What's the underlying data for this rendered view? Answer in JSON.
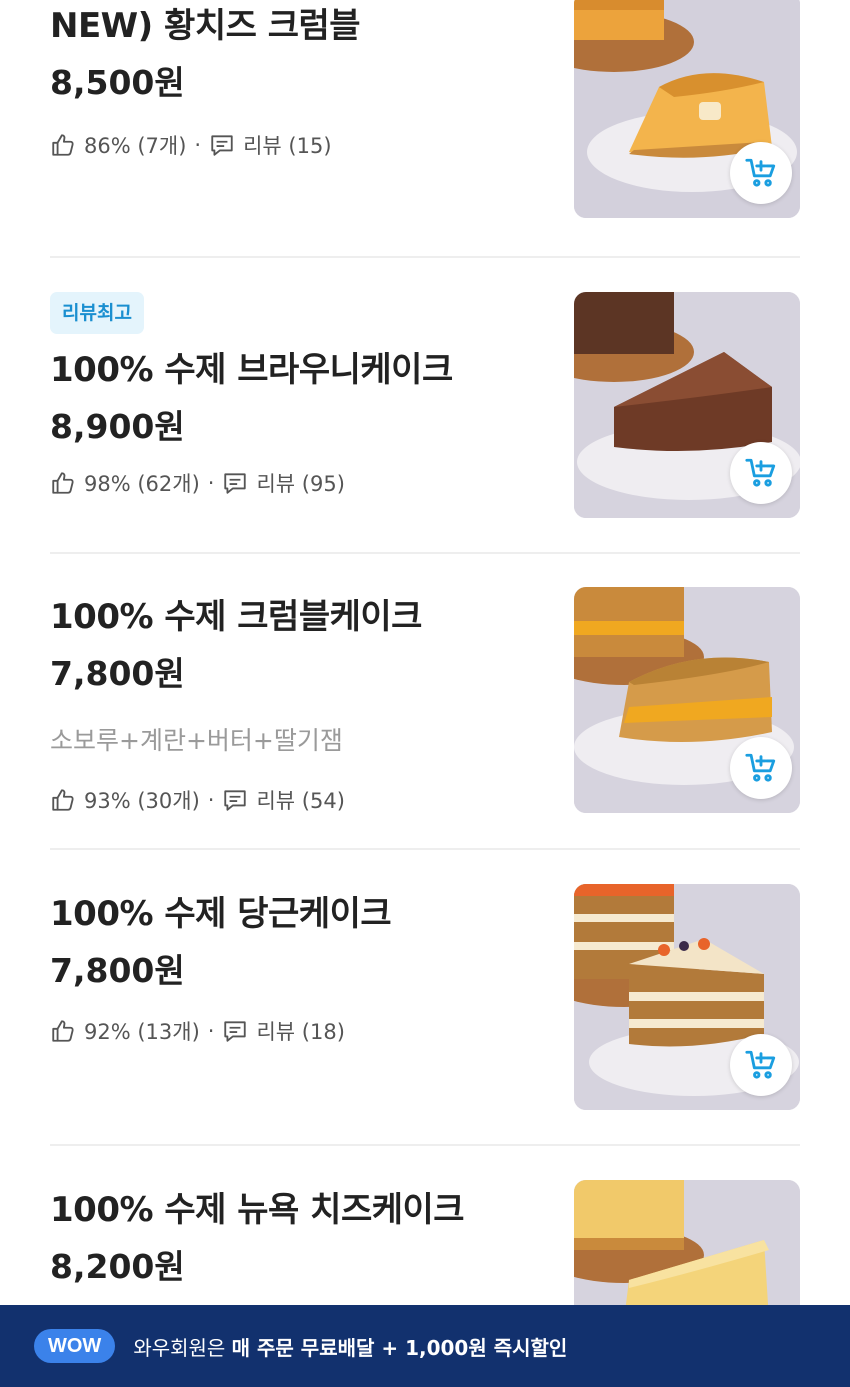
{
  "items": [
    {
      "name": "NEW) 황치즈 크럼블",
      "price": "8,500원",
      "like_stat": "86% (7개)",
      "review_stat": "리뷰 (15)"
    },
    {
      "badge": "리뷰최고",
      "name": "100% 수제 브라우니케이크",
      "price": "8,900원",
      "like_stat": "98% (62개)",
      "review_stat": "리뷰 (95)"
    },
    {
      "name": "100% 수제 크럼블케이크",
      "price": "7,800원",
      "description": "소보루+계란+버터+딸기잼",
      "like_stat": "93% (30개)",
      "review_stat": "리뷰 (54)"
    },
    {
      "name": "100% 수제 당근케이크",
      "price": "7,800원",
      "like_stat": "92% (13개)",
      "review_stat": "리뷰 (18)"
    },
    {
      "name": "100% 수제 뉴욕 치즈케이크",
      "price": "8,200원"
    }
  ],
  "meta_separator": "·",
  "icons": {
    "like": "thumbs-up-icon",
    "review": "comment-icon",
    "cart": "cart-plus-icon"
  },
  "wow_bar": {
    "badge": "WOW",
    "text_prefix": "와우회원은 ",
    "text_strong": "매 주문 무료배달 + 1,000원 즉시할인"
  },
  "colors": {
    "accent": "#1a9ee0",
    "badge_bg": "#e4f4fc",
    "wow_bar_bg": "#12316e",
    "wow_badge_bg": "#3b82ea"
  }
}
